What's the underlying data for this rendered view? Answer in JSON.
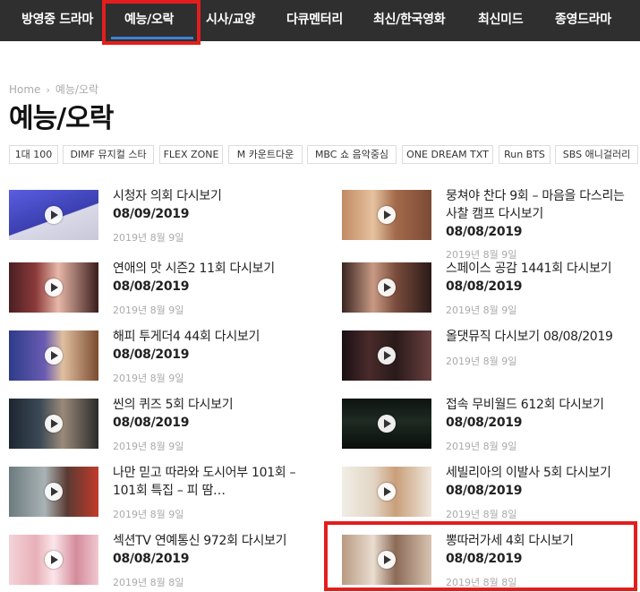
{
  "colors": {
    "nav_bg": "#2f2f2f",
    "accent": "#3b82d6",
    "highlight": "#e31e1e",
    "muted": "#aaaaaa"
  },
  "nav": {
    "items": [
      "방영중 드라마",
      "예능/오락",
      "시사/교양",
      "다큐멘터리",
      "최신/한국영화",
      "최신미드",
      "종영드라마"
    ],
    "active": "예능/오락"
  },
  "breadcrumb": {
    "home": "Home",
    "sep": "›",
    "current": "예능/오락"
  },
  "page_title": "예능/오락",
  "tags": [
    "1대 100",
    "DIMF 뮤지컬 스타",
    "FLEX ZONE",
    "M 카운트다운",
    "MBC 쇼 음악중심",
    "ONE DREAM TXT",
    "Run BTS",
    "SBS 애니걸러리"
  ],
  "left_posts": [
    {
      "title": "시청자 의회 다시보기",
      "subtitle": "08/09/2019",
      "date": "2019년 8월 9일",
      "thumb": "studio-panel"
    },
    {
      "title": "연애의 맛 시즌2 11회 다시보기",
      "subtitle": "08/08/2019",
      "date": "2019년 8월 9일",
      "thumb": "couple"
    },
    {
      "title": "해피 투게더4 44회 다시보기",
      "subtitle": "08/08/2019",
      "date": "2019년 8월 9일",
      "thumb": "talk-show"
    },
    {
      "title": "씬의 퀴즈 5회 다시보기",
      "subtitle": "08/08/2019",
      "date": "2019년 8월 9일",
      "thumb": "quiz"
    },
    {
      "title": "나만 믿고 따라와 도시어부 101회 – 101회 특집 – 피 땀…",
      "subtitle": "",
      "date": "2019년 8월 9일",
      "thumb": "fishing"
    },
    {
      "title": "섹션TV 연예통신 972회 다시보기",
      "subtitle": "08/08/2019",
      "date": "2019년 8월 8일",
      "thumb": "celebs"
    }
  ],
  "right_posts": [
    {
      "title": "뭉쳐야 찬다 9회 – 마음을 다스리는 사찰 캠프 다시보기",
      "subtitle": "08/08/2019",
      "date": "2019년 8월 9일",
      "thumb": "temple",
      "caption": ""
    },
    {
      "title": "스페이스 공감 1441회 다시보기",
      "subtitle": "08/08/2019",
      "date": "2019년 8월 9일",
      "thumb": "audience",
      "caption": ""
    },
    {
      "title": "올댓뮤직 다시보기 08/08/2019",
      "subtitle": "",
      "date": "2019년 8월 9일",
      "thumb": "stage",
      "caption": ""
    },
    {
      "title": "접속 무비월드 612회 다시보기",
      "subtitle": "08/08/2019",
      "date": "2019년 8월 9일",
      "thumb": "movie",
      "caption": ""
    },
    {
      "title": "세빌리아의 이발사 5회 다시보기",
      "subtitle": "08/08/2019",
      "date": "2019년 8월 8일",
      "thumb": "barber",
      "caption": ""
    },
    {
      "title": "뽕따러가세 4회 다시보기",
      "subtitle": "08/08/2019",
      "date": "2019년 8월 8일",
      "thumb": "car",
      "caption": ""
    }
  ]
}
